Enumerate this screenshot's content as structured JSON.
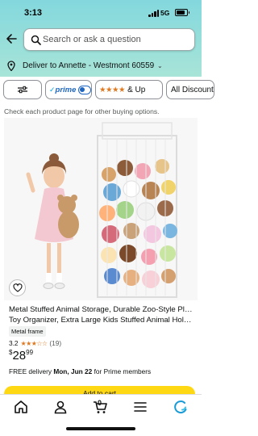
{
  "status_bar": {
    "time": "3:13",
    "network": "5G"
  },
  "search": {
    "placeholder": "Search or ask a question"
  },
  "location": {
    "text": "Deliver to Annette - Westmont 60559"
  },
  "filters": {
    "prime_label": "prime",
    "rating_label": "& Up",
    "discount_label": "All Discounts"
  },
  "notice": "Check each product page for other buying options.",
  "product": {
    "title_line1": "Metal Stuffed Animal Storage, Durable Zoo-Style Plush",
    "title_line2": "Toy Organizer, Extra Large Kids Stuffed Animal Holder…",
    "badge": "Metal frame",
    "rating_value": "3.2",
    "rating_count": "(19)",
    "rating_stars": 3.2,
    "price_symbol": "$",
    "price_whole": "28",
    "price_fraction": "99",
    "delivery_prefix": "FREE delivery ",
    "delivery_date": "Mon, Jun 22",
    "delivery_suffix": " for Prime members",
    "cta": "Add to cart"
  },
  "nav": {
    "cart_count": "0"
  },
  "colors": {
    "header_top": "#83d8dd",
    "header_bottom": "#a8e4d8",
    "cta": "#ffd814",
    "star": "#de7921",
    "prime": "#1f66c1"
  },
  "icons": [
    "back-arrow-icon",
    "search-icon",
    "location-pin-icon",
    "filter-sliders-icon",
    "heart-icon",
    "home-icon",
    "account-icon",
    "cart-icon",
    "menu-icon",
    "rufus-ai-icon"
  ]
}
